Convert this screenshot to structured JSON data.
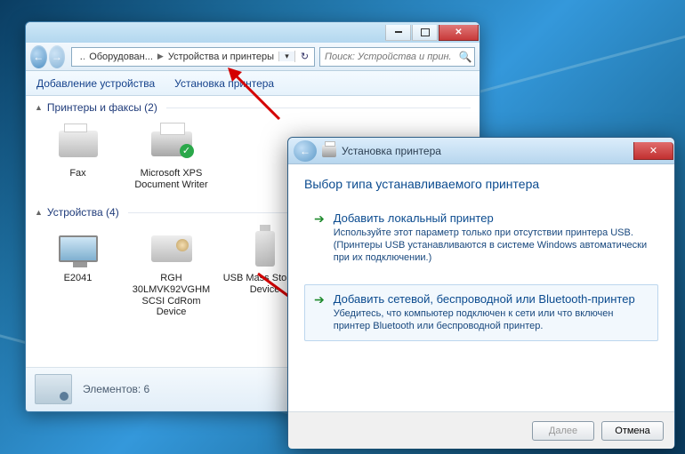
{
  "explorer": {
    "breadcrumb_part1": "Оборудован...",
    "breadcrumb_part2": "Устройства и принтеры",
    "search_placeholder": "Поиск: Устройства и прин...",
    "toolbar": {
      "add_device": "Добавление устройства",
      "add_printer": "Установка принтера"
    },
    "group_printers": "Принтеры и факсы (2)",
    "group_devices": "Устройства (4)",
    "items_printers": [
      {
        "label": "Fax"
      },
      {
        "label": "Microsoft XPS Document Writer"
      }
    ],
    "items_devices": [
      {
        "label": "E2041"
      },
      {
        "label": "RGH 30LMVK92VGHM SCSI CdRom Device"
      },
      {
        "label": "USB Mass Storage Device"
      }
    ],
    "status_label": "Элементов: 6"
  },
  "wizard": {
    "title": "Установка принтера",
    "heading": "Выбор типа устанавливаемого принтера",
    "opt1_title": "Добавить локальный принтер",
    "opt1_desc": "Используйте этот параметр только при отсутствии принтера USB. (Принтеры USB устанавливаются в системе Windows автоматически при их подключении.)",
    "opt2_title": "Добавить сетевой, беспроводной или Bluetooth-принтер",
    "opt2_desc": "Убедитесь, что компьютер подключен к сети или что включен принтер Bluetooth или беспроводной принтер.",
    "btn_next": "Далее",
    "btn_cancel": "Отмена"
  }
}
